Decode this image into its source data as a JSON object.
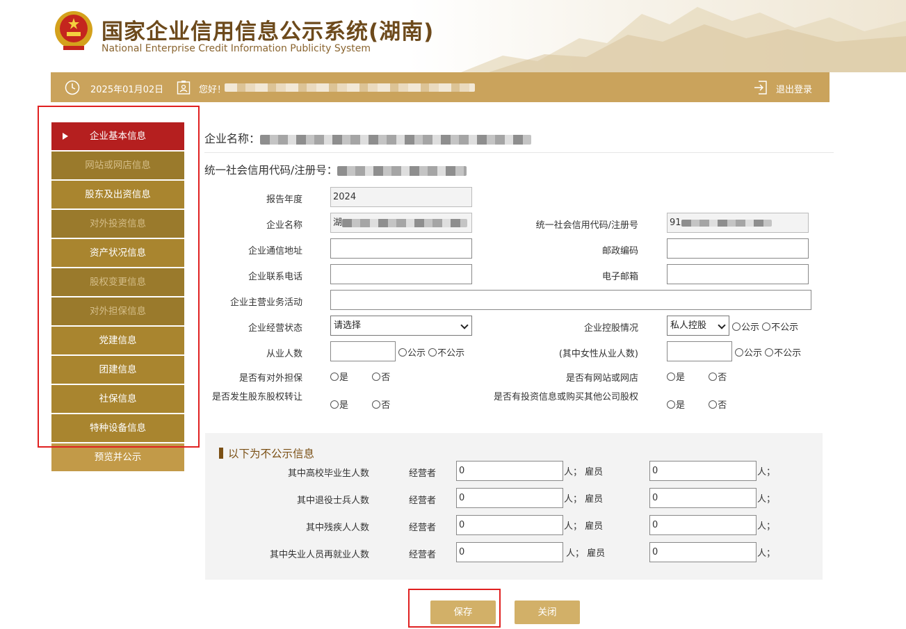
{
  "header": {
    "title_cn": "国家企业信用信息公示系统(湖南)",
    "title_en": "National Enterprise Credit Information Publicity System"
  },
  "topbar": {
    "date": "2025年01月02日",
    "greeting": "您好！",
    "logout": "退出登录"
  },
  "sidebar": {
    "items": [
      {
        "label": "企业基本信息"
      },
      {
        "label": "网站或网店信息"
      },
      {
        "label": "股东及出资信息"
      },
      {
        "label": "对外投资信息"
      },
      {
        "label": "资产状况信息"
      },
      {
        "label": "股权变更信息"
      },
      {
        "label": "对外担保信息"
      },
      {
        "label": "党建信息"
      },
      {
        "label": "团建信息"
      },
      {
        "label": "社保信息"
      },
      {
        "label": "特种设备信息"
      },
      {
        "label": "预览并公示"
      }
    ]
  },
  "main": {
    "company_label": "企业名称：",
    "code_label": "统一社会信用代码/注册号：",
    "form": {
      "report_year_label": "报告年度",
      "report_year_value": "2024",
      "name_label": "企业名称",
      "name_value": "湖",
      "credit_code_label": "统一社会信用代码/注册号",
      "credit_code_value": "91",
      "address_label": "企业通信地址",
      "postcode_label": "邮政编码",
      "phone_label": "企业联系电话",
      "email_label": "电子邮箱",
      "business_label": "企业主营业务活动",
      "status_label": "企业经营状态",
      "status_value": "请选择",
      "holding_label": "企业控股情况",
      "holding_value": "私人控股",
      "employees_label": "从业人数",
      "female_label": "(其中女性从业人数)",
      "guarantee_label": "是否有对外担保",
      "website_label": "是否有网站或网店",
      "equity_transfer_label": "是否发生股东股权转让",
      "investment_label": "是否有投资信息或购买其他公司股权",
      "public": "公示",
      "not_public": "不公示",
      "yes": "是",
      "no": "否"
    }
  },
  "non_public": {
    "title": "以下为不公示信息",
    "operator": "经营者",
    "employee": "人；  雇员",
    "person": "人；",
    "rows": [
      {
        "label": "其中高校毕业生人数",
        "operator_value": "0",
        "employee_value": "0"
      },
      {
        "label": "其中退役士兵人数",
        "operator_value": "0",
        "employee_value": "0"
      },
      {
        "label": "其中残疾人人数",
        "operator_value": "0",
        "employee_value": "0"
      },
      {
        "label": "其中失业人员再就业人数",
        "operator_value": "0",
        "employee_value": "0"
      }
    ]
  },
  "buttons": {
    "save": "保存",
    "close": "关闭"
  }
}
